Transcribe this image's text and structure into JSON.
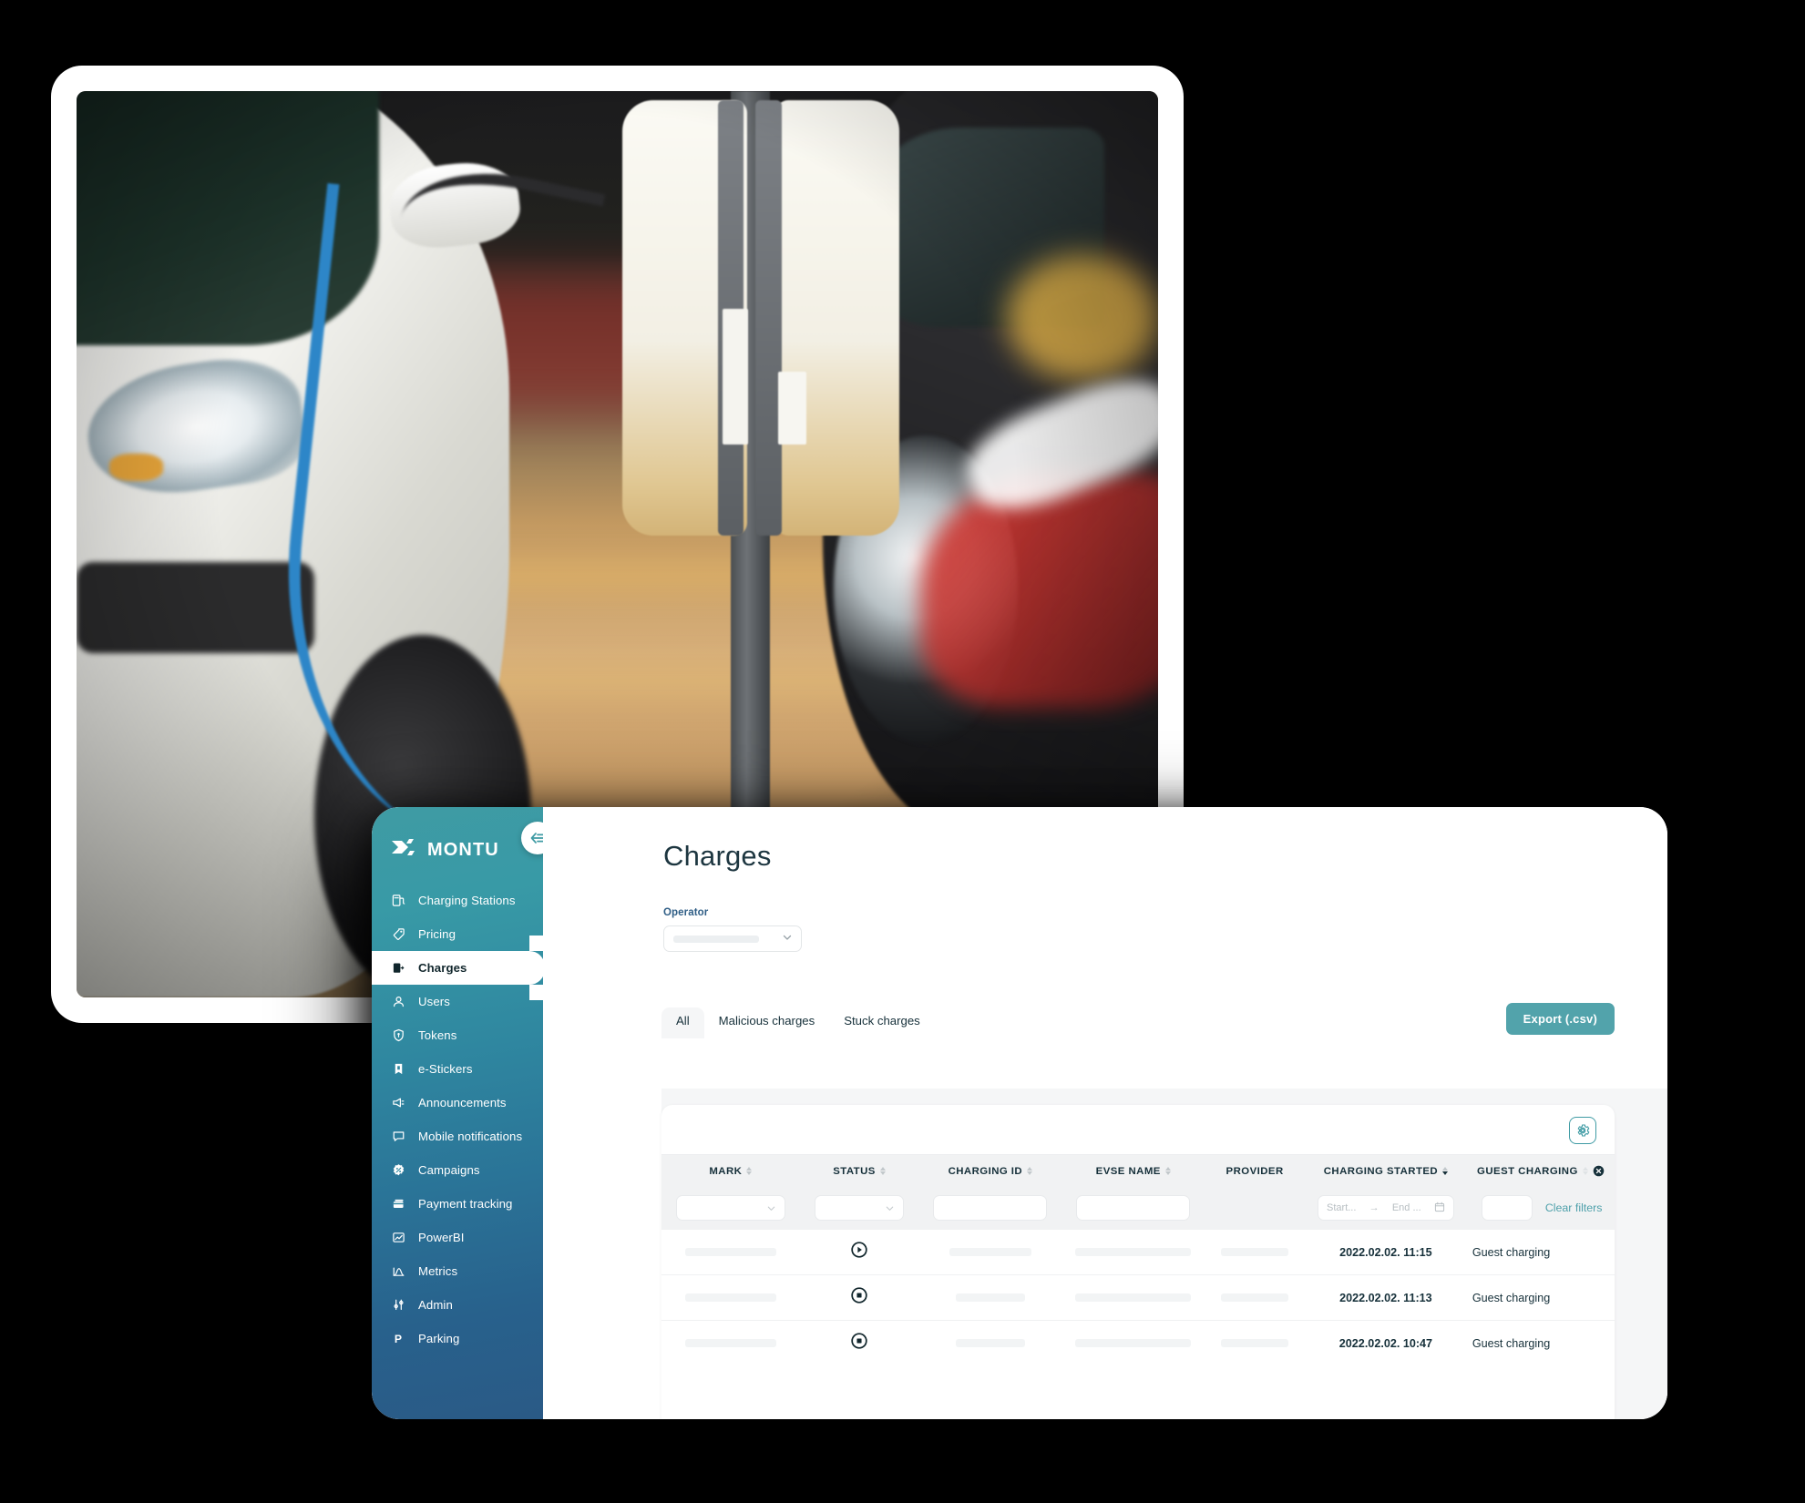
{
  "app": {
    "brand_name": "MONTU",
    "collapse_icon": "collapse-left-icon"
  },
  "sidebar": {
    "items": [
      {
        "label": "Charging Stations",
        "icon": "charging-station-icon",
        "active": false
      },
      {
        "label": "Pricing",
        "icon": "tag-icon",
        "active": false
      },
      {
        "label": "Charges",
        "icon": "battery-bolt-icon",
        "active": true
      },
      {
        "label": "Users",
        "icon": "user-icon",
        "active": false
      },
      {
        "label": "Tokens",
        "icon": "shield-key-icon",
        "active": false
      },
      {
        "label": "e-Stickers",
        "icon": "sticker-icon",
        "active": false
      },
      {
        "label": "Announcements",
        "icon": "megaphone-icon",
        "active": false
      },
      {
        "label": "Mobile notifications",
        "icon": "chat-bubble-icon",
        "active": false
      },
      {
        "label": "Campaigns",
        "icon": "badge-percent-icon",
        "active": false
      },
      {
        "label": "Payment tracking",
        "icon": "credit-card-icon",
        "active": false
      },
      {
        "label": "PowerBI",
        "icon": "chart-image-icon",
        "active": false
      },
      {
        "label": "Metrics",
        "icon": "metrics-curve-icon",
        "active": false
      },
      {
        "label": "Admin",
        "icon": "sliders-icon",
        "active": false
      },
      {
        "label": "Parking",
        "icon": "parking-p-icon",
        "active": false
      }
    ]
  },
  "main": {
    "page_title": "Charges",
    "operator_filter": {
      "label": "Operator",
      "value": "",
      "chevron_icon": "chevron-down-icon"
    },
    "tabs": [
      {
        "label": "All",
        "active": true
      },
      {
        "label": "Malicious charges",
        "active": false
      },
      {
        "label": "Stuck charges",
        "active": false
      }
    ],
    "export_button": "Export (.csv)",
    "table_settings_icon": "gear-icon"
  },
  "table": {
    "columns": [
      {
        "label": "MARK",
        "sortable": true,
        "sort": "none"
      },
      {
        "label": "STATUS",
        "sortable": true,
        "sort": "none"
      },
      {
        "label": "CHARGING ID",
        "sortable": true,
        "sort": "none"
      },
      {
        "label": "EVSE NAME",
        "sortable": true,
        "sort": "none"
      },
      {
        "label": "PROVIDER",
        "sortable": false,
        "sort": "none"
      },
      {
        "label": "CHARGING STARTED",
        "sortable": true,
        "sort": "desc"
      },
      {
        "label": "GUEST CHARGING",
        "sortable": true,
        "sort": "none"
      }
    ],
    "filters": {
      "mark_placeholder": "",
      "status_placeholder": "",
      "charging_id_placeholder": "",
      "evse_name_placeholder": "",
      "date_start_placeholder": "Start...",
      "date_arrow": "→",
      "date_end_placeholder": "End ...",
      "calendar_icon": "calendar-icon",
      "guest_placeholder": "",
      "clear_filters": "Clear filters",
      "close_icon": "close-circle-icon"
    },
    "rows": [
      {
        "mark": "",
        "status_icon": "play-circle-icon",
        "charging_id": "",
        "evse_name": "",
        "provider": "",
        "charging_started": "2022.02.02. 11:15",
        "guest_charging": "Guest charging"
      },
      {
        "mark": "",
        "status_icon": "stop-circle-icon",
        "charging_id": "",
        "evse_name": "",
        "provider": "",
        "charging_started": "2022.02.02. 11:13",
        "guest_charging": "Guest charging"
      },
      {
        "mark": "",
        "status_icon": "stop-circle-icon",
        "charging_id": "",
        "evse_name": "",
        "provider": "",
        "charging_started": "2022.02.02. 10:47",
        "guest_charging": "Guest charging"
      }
    ]
  },
  "hero_photo": {
    "alt": "electric vehicle plugged into a charging station in a parking garage"
  },
  "colors": {
    "brand_teal": "#3f9ba4",
    "sidebar_bottom": "#2a5a86",
    "export_button": "#52a3ab",
    "accent_link": "#4fa1ab",
    "text_dark": "#16303a",
    "label_blue": "#2f5e86",
    "page_bg": "#000000"
  }
}
